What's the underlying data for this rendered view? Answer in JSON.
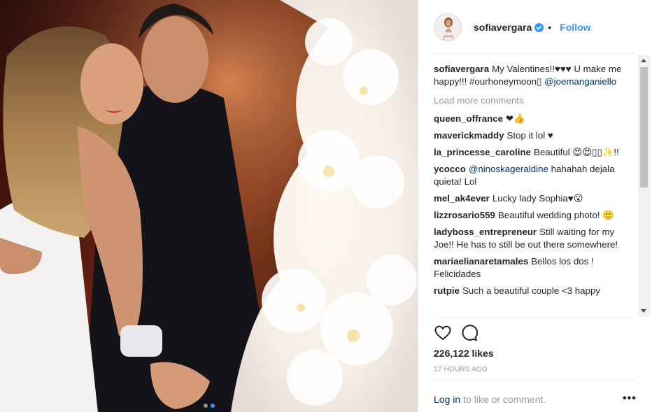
{
  "post": {
    "username": "sofiavergara",
    "dot": "•",
    "follow_label": "Follow",
    "caption": {
      "user": "sofiavergara",
      "text": "My Valentines!!♥♥♥ U make me happy!!! #ourhoneymoon▯",
      "mention": "@joemanganiello"
    },
    "load_more_label": "Load more comments",
    "comments": [
      {
        "user": "queen_offrance",
        "text": "❤👍"
      },
      {
        "user": "maverickmaddy",
        "text": "Stop it lol ♥"
      },
      {
        "user": "la_princesse_caroline",
        "text": "Beautiful 😍😍▯▯✨!!"
      },
      {
        "user": "ycocco",
        "mention": "@ninoskageraldine",
        "text": "hahahah dejala quieta! Lol"
      },
      {
        "user": "mel_ak4ever",
        "text": "Lucky lady Sophia♥😮"
      },
      {
        "user": "lizzrosario559",
        "text": "Beautiful wedding photo! 🙂"
      },
      {
        "user": "ladyboss_entrepreneur",
        "text": "Still waiting for my Joe!! He has to still be out there somewhere!"
      },
      {
        "user": "mariaelianaretamales",
        "text": "Bellos los dos ! Felicidades"
      },
      {
        "user": "rutpie",
        "text": "Such a beautiful couple <3 happy"
      }
    ],
    "likes": "226,122 likes",
    "timestamp": "17 HOURS AGO",
    "login_link": "Log in",
    "login_suffix": " to like or comment.",
    "more_label": "•••"
  },
  "icons": {
    "verified": "verified-badge-icon",
    "like": "heart-icon",
    "comment": "comment-bubble-icon"
  },
  "colors": {
    "accent": "#3897f0",
    "mention": "#003569",
    "muted": "#999999",
    "text": "#262626"
  },
  "carousel": {
    "slides": 2,
    "active": 1
  }
}
